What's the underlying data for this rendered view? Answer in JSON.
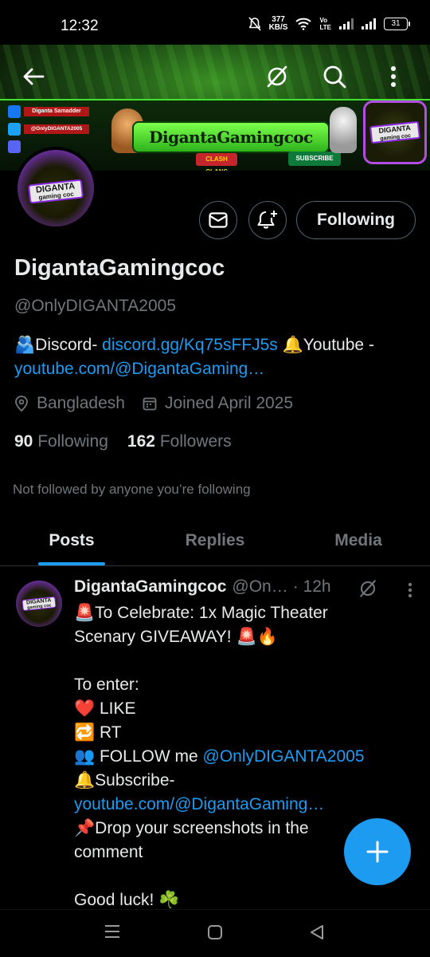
{
  "status_bar": {
    "time": "12:32",
    "net_speed_value": "377",
    "net_speed_unit": "KB/S",
    "volte_top": "Vo",
    "volte_bottom": "LTE",
    "battery": "31"
  },
  "banner": {
    "channel_title": "DigantaGamingcoc",
    "name_plate": "Diganta Samadder",
    "handle_plate": "@OnlyDIGANTA2005",
    "game_badge": "CLASH CLANS",
    "subscribe_label": "SUBSCRIBE",
    "logo_text": "DIGANTA",
    "logo_subtext": "gaming coc"
  },
  "profile": {
    "avatar_text": "DIGANTA",
    "avatar_subtext": "gaming coc",
    "display_name": "DigantaGamingcoc",
    "handle": "@OnlyDIGANTA2005",
    "bio_discord_prefix": "🫂Discord- ",
    "bio_discord_link": "discord.gg/Kq75sFFJ5s",
    "bio_youtube_prefix": " 🔔Youtube - ",
    "bio_youtube_link": "youtube.com/@DigantaGaming…",
    "location": "Bangladesh",
    "joined": "Joined April 2025",
    "following_count": "90",
    "following_label": "Following",
    "followers_count": "162",
    "followers_label": "Followers",
    "not_followed_text": "Not followed by anyone you’re following",
    "following_button": "Following"
  },
  "tabs": [
    {
      "label": "Posts",
      "active": true
    },
    {
      "label": "Replies",
      "active": false
    },
    {
      "label": "Media",
      "active": false
    }
  ],
  "post": {
    "author": "DigantaGamingcoc",
    "handle": "@On…",
    "time": "· 12h",
    "line1": "🚨To Celebrate: 1x Magic Theater",
    "line2": "Scenary GIVEAWAY! 🚨🔥",
    "line3": "To enter:",
    "line4": "❤️ LIKE",
    "line5": "🔁 RT",
    "line6_prefix": "👥 FOLLOW me ",
    "line6_mention": "@OnlyDIGANTA2005",
    "line7": "🔔Subscribe-",
    "line8_link": "youtube.com/@DigantaGaming…",
    "line9": "📌Drop your screenshots in the",
    "line10": "comment",
    "line11": "Good luck! ☘️"
  },
  "colors": {
    "accent": "#1d9bf0",
    "muted": "#71767b",
    "text": "#e7e9ea",
    "background": "#000000"
  }
}
